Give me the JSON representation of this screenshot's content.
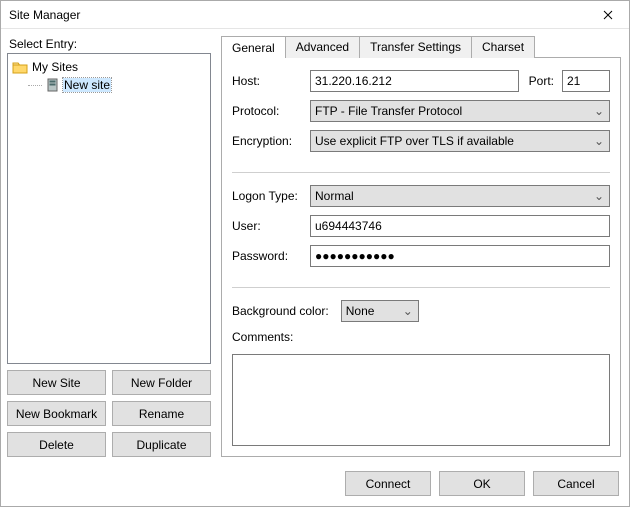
{
  "window": {
    "title": "Site Manager"
  },
  "left": {
    "heading": "Select Entry:",
    "tree": {
      "root": "My Sites",
      "site": "New site"
    },
    "buttons": {
      "new_site": "New Site",
      "new_folder": "New Folder",
      "new_bookmark": "New Bookmark",
      "rename": "Rename",
      "delete": "Delete",
      "duplicate": "Duplicate"
    }
  },
  "tabs": {
    "general": "General",
    "advanced": "Advanced",
    "transfer": "Transfer Settings",
    "charset": "Charset"
  },
  "form": {
    "host_label": "Host:",
    "host_value": "31.220.16.212",
    "port_label": "Port:",
    "port_value": "21",
    "protocol_label": "Protocol:",
    "protocol_value": "FTP - File Transfer Protocol",
    "encryption_label": "Encryption:",
    "encryption_value": "Use explicit FTP over TLS if available",
    "logon_label": "Logon Type:",
    "logon_value": "Normal",
    "user_label": "User:",
    "user_value": "u694443746",
    "password_label": "Password:",
    "password_value": "●●●●●●●●●●●",
    "bgcolor_label": "Background color:",
    "bgcolor_value": "None",
    "comments_label": "Comments:",
    "comments_value": ""
  },
  "footer": {
    "connect": "Connect",
    "ok": "OK",
    "cancel": "Cancel"
  }
}
